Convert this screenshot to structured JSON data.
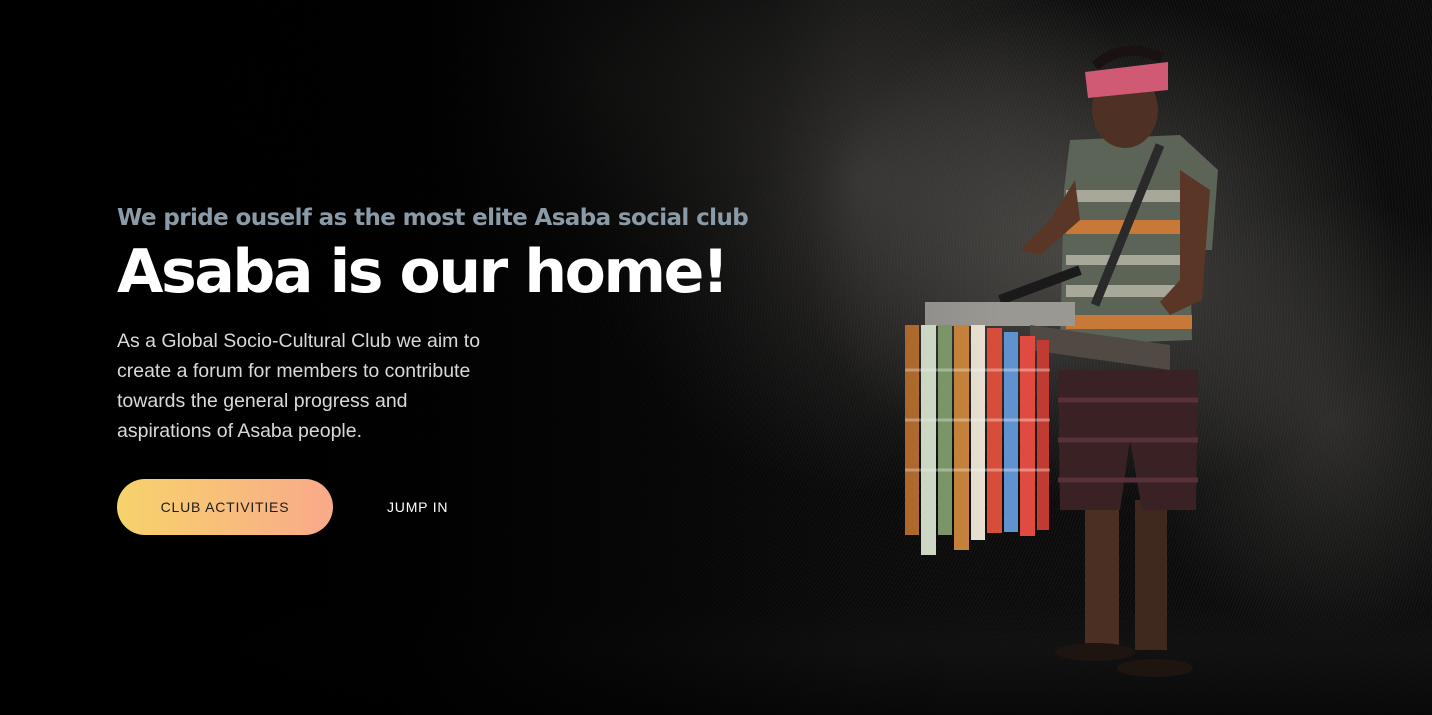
{
  "hero": {
    "eyebrow": "We pride ouself as the most elite Asaba social club",
    "title": "Asaba is our home!",
    "description": "As a Global Socio-Cultural Club we aim to create a forum for members to contribute towards the general progress and aspirations of Asaba people.",
    "primary_button": "CLUB ACTIVITIES",
    "secondary_button": "JUMP IN",
    "background_image": "street-vendor-photo",
    "colors": {
      "eyebrow": "#8a9aa6",
      "title": "#ffffff",
      "button_gradient_start": "#f7d36b",
      "button_gradient_end": "#f9a98a"
    }
  }
}
